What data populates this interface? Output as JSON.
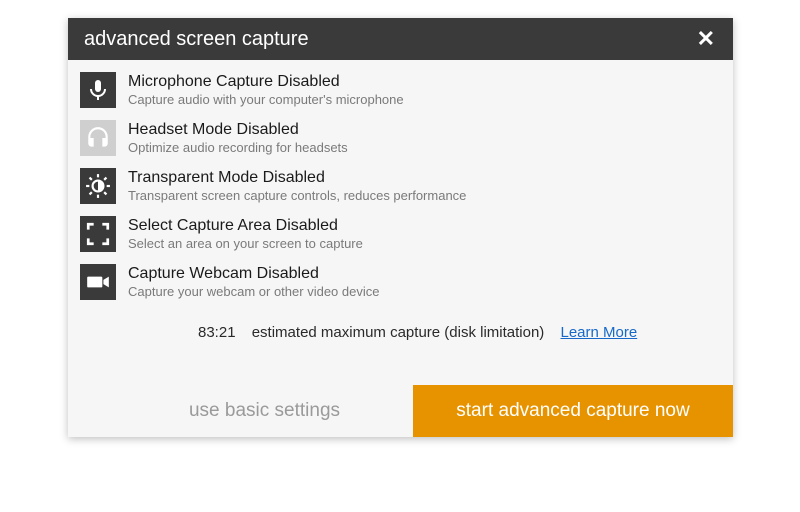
{
  "dialog": {
    "title": "advanced screen capture",
    "close_label": "✕"
  },
  "options": [
    {
      "title": "Microphone Capture Disabled",
      "desc": "Capture audio with your computer's microphone"
    },
    {
      "title": "Headset Mode Disabled",
      "desc": "Optimize audio recording for headsets"
    },
    {
      "title": "Transparent Mode Disabled",
      "desc": "Transparent screen capture controls, reduces performance"
    },
    {
      "title": "Select Capture Area Disabled",
      "desc": "Select an area on your screen to capture"
    },
    {
      "title": "Capture Webcam Disabled",
      "desc": "Capture your webcam or other video device"
    }
  ],
  "estimate": {
    "time": "83:21",
    "label": "estimated maximum capture (disk limitation)",
    "learn_more": "Learn More"
  },
  "footer": {
    "basic": "use basic settings",
    "start": "start advanced capture now"
  }
}
